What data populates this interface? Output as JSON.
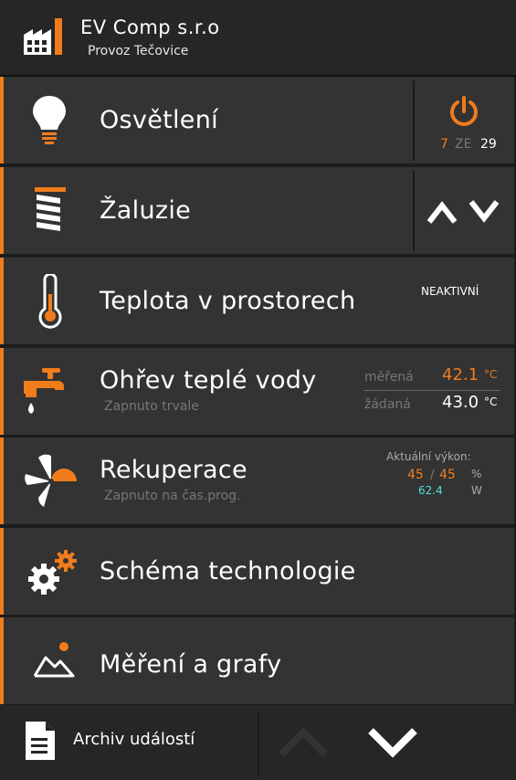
{
  "header": {
    "title": "EV Comp s.r.o",
    "subtitle": "Provoz Tečovice"
  },
  "rows": {
    "lights": {
      "label": "Osvětlení",
      "on_count": "7",
      "of_word": "ZE",
      "total": "29"
    },
    "blinds": {
      "label": "Žaluzie"
    },
    "temperature": {
      "label": "Teplota v prostorech",
      "status": "NEAKTIVNÍ"
    },
    "hot_water": {
      "label": "Ohřev teplé vody",
      "sublabel": "Zapnuto trvale",
      "measured_label": "měřená",
      "measured_value": "42.1",
      "measured_unit": "°C",
      "set_label": "žádaná",
      "set_value": "43.0",
      "set_unit": "°C"
    },
    "recuperation": {
      "label": "Rekuperace",
      "sublabel": "Zapnuto na čas.prog.",
      "power_label": "Aktuální výkon:",
      "power_a": "45",
      "slash": "/",
      "power_b": "45",
      "percent_unit": "%",
      "watts": "62.4",
      "watt_unit": "W"
    },
    "schema": {
      "label": "Schéma technologie"
    },
    "measurements": {
      "label": "Měření a grafy"
    }
  },
  "footer": {
    "archive_label": "Archiv událostí"
  },
  "colors": {
    "accent": "#f07c1c",
    "row_bg": "#333333",
    "cyan": "#4ee0e0"
  },
  "icons": [
    "factory-icon",
    "bulb-icon",
    "power-icon",
    "blinds-icon",
    "chevron-up-icon",
    "chevron-down-icon",
    "thermometer-icon",
    "water-tap-icon",
    "fan-icon",
    "gears-icon",
    "chart-icon",
    "document-icon"
  ]
}
